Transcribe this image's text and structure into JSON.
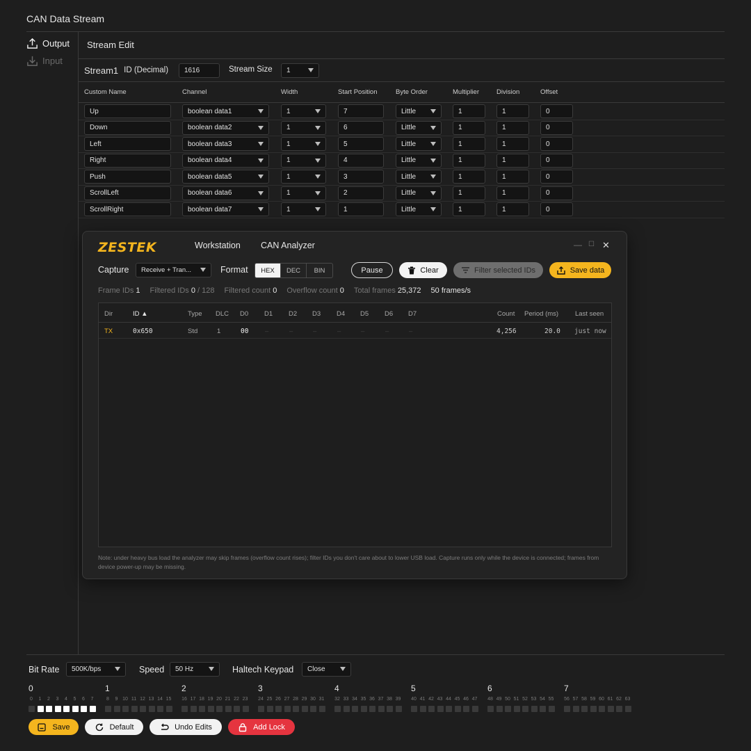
{
  "app": {
    "title": "CAN Data Stream"
  },
  "sidebar": {
    "items": [
      {
        "label": "Output",
        "icon": "upload-icon",
        "active": true
      },
      {
        "label": "Input",
        "icon": "download-icon",
        "active": false
      }
    ]
  },
  "editor": {
    "title": "Stream Edit",
    "stream_name": "Stream1",
    "id_label": "ID (Decimal)",
    "id_value": "1616",
    "size_label": "Stream Size",
    "size_value": "1",
    "columns": [
      "Custom Name",
      "Channel",
      "Width",
      "Start Position",
      "Byte Order",
      "Multiplier",
      "Division",
      "Offset"
    ],
    "rows": [
      {
        "name": "Up",
        "channel": "boolean data1",
        "width": "1",
        "start": "7",
        "order": "Little",
        "mult": "1",
        "div": "1",
        "offset": "0"
      },
      {
        "name": "Down",
        "channel": "boolean data2",
        "width": "1",
        "start": "6",
        "order": "Little",
        "mult": "1",
        "div": "1",
        "offset": "0"
      },
      {
        "name": "Left",
        "channel": "boolean data3",
        "width": "1",
        "start": "5",
        "order": "Little",
        "mult": "1",
        "div": "1",
        "offset": "0"
      },
      {
        "name": "Right",
        "channel": "boolean data4",
        "width": "1",
        "start": "4",
        "order": "Little",
        "mult": "1",
        "div": "1",
        "offset": "0"
      },
      {
        "name": "Push",
        "channel": "boolean data5",
        "width": "1",
        "start": "3",
        "order": "Little",
        "mult": "1",
        "div": "1",
        "offset": "0"
      },
      {
        "name": "ScrollLeft",
        "channel": "boolean data6",
        "width": "1",
        "start": "2",
        "order": "Little",
        "mult": "1",
        "div": "1",
        "offset": "0"
      },
      {
        "name": "ScrollRight",
        "channel": "boolean data7",
        "width": "1",
        "start": "1",
        "order": "Little",
        "mult": "1",
        "div": "1",
        "offset": "0"
      }
    ]
  },
  "analyzer": {
    "logo": "ZESTEK",
    "menu": [
      "Workstation",
      "CAN Analyzer"
    ],
    "window_controls": {
      "minimize": "—",
      "maximize": "☐",
      "close": "✕"
    },
    "capture_label": "Capture",
    "capture_value": "Receive + Tran...",
    "format_label": "Format",
    "formats": [
      "HEX",
      "DEC",
      "BIN"
    ],
    "selected_format": "HEX",
    "buttons": {
      "pause": "Pause",
      "clear": "Clear",
      "filter": "Filter selected IDs",
      "save": "Save data"
    },
    "stats": [
      {
        "label": "Frame IDs",
        "value": "1"
      },
      {
        "label": "Filtered IDs",
        "value": "0",
        "suffix": "/ 128"
      },
      {
        "label": "Filtered count",
        "value": "0"
      },
      {
        "label": "Overflow count",
        "value": "0"
      },
      {
        "label": "Total frames",
        "value": "25,372"
      },
      {
        "label": "",
        "value": "50",
        "suffix": "frames/s"
      }
    ],
    "columns": [
      "Dir",
      "ID ▲",
      "Type",
      "DLC",
      "D0",
      "D1",
      "D2",
      "D3",
      "D4",
      "D5",
      "D6",
      "D7",
      "Count",
      "Period (ms)",
      "Last seen"
    ],
    "frames": [
      {
        "dir": "TX",
        "id": "0x650",
        "type": "Std",
        "dlc": "1",
        "d": [
          "00",
          "–",
          "–",
          "–",
          "–",
          "–",
          "–",
          "–"
        ],
        "count": "4,256",
        "period": "20.0",
        "last": "just now"
      }
    ],
    "note": "Note: under heavy bus load the analyzer may skip frames (overflow count rises); filter IDs you don't care about to lower USB load. Capture runs only while the device is connected; frames from device power-up may be missing."
  },
  "footer": {
    "bitrate_label": "Bit Rate",
    "bitrate_value": "500K/bps",
    "speed_label": "Speed",
    "speed_value": "50 Hz",
    "keypad_label": "Haltech Keypad",
    "keypad_value": "Close",
    "bytes": [
      "0",
      "1",
      "2",
      "3",
      "4",
      "5",
      "6",
      "7"
    ],
    "bit_states": [
      0,
      1,
      1,
      1,
      1,
      1,
      1,
      1,
      0,
      0,
      0,
      0,
      0,
      0,
      0,
      0,
      0,
      0,
      0,
      0,
      0,
      0,
      0,
      0,
      0,
      0,
      0,
      0,
      0,
      0,
      0,
      0,
      0,
      0,
      0,
      0,
      0,
      0,
      0,
      0,
      0,
      0,
      0,
      0,
      0,
      0,
      0,
      0,
      0,
      0,
      0,
      0,
      0,
      0,
      0,
      0,
      0,
      0,
      0,
      0,
      0,
      0,
      0,
      0
    ],
    "buttons": {
      "save": "Save",
      "default": "Default",
      "undo": "Undo Edits",
      "lock": "Add Lock"
    },
    "colors": {
      "accent": "#f4b51e",
      "danger": "#e5343f"
    }
  }
}
